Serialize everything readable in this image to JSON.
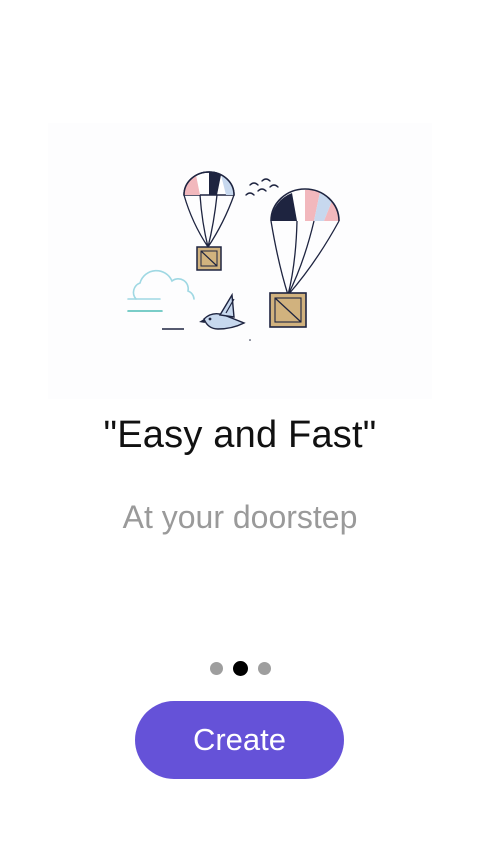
{
  "onboarding": {
    "title": "\"Easy and Fast\"",
    "subtitle": "At your doorstep",
    "illustration": "parachute-delivery-illustration",
    "page_indicator": {
      "total": 3,
      "active_index": 1
    }
  },
  "actions": {
    "create_label": "Create"
  },
  "colors": {
    "accent": "#6552d8",
    "title_text": "#111111",
    "subtitle_text": "#9a9a9a",
    "dot_inactive": "#9e9e9e",
    "dot_active": "#000000"
  }
}
